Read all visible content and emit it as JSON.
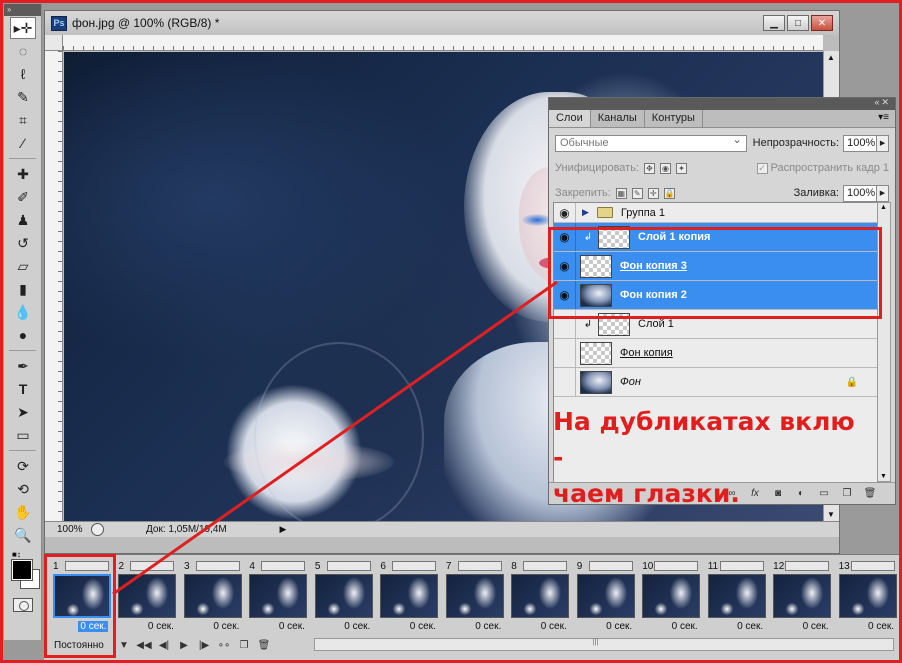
{
  "document": {
    "title": "фон.jpg @ 100% (RGB/8) *",
    "ps_badge": "Ps",
    "zoom": "100%",
    "doc_info": "Док: 1,05M/19,4M"
  },
  "layers_panel": {
    "tabs": [
      "Слои",
      "Каналы",
      "Контуры"
    ],
    "blend_mode": "Обычные",
    "opacity_label": "Непрозрачность:",
    "opacity_value": "100%",
    "unify_label": "Унифицировать:",
    "propagate_label": "Распространить кадр 1",
    "lock_label": "Закрепить:",
    "fill_label": "Заливка:",
    "fill_value": "100%",
    "layers": [
      {
        "name": "Группа 1",
        "type": "group",
        "visible": true,
        "selected": false
      },
      {
        "name": "Слой 1 копия",
        "type": "clipped",
        "visible": true,
        "selected": true
      },
      {
        "name": "Фон копия 3",
        "type": "transparent",
        "visible": true,
        "selected": true
      },
      {
        "name": "Фон копия 2",
        "type": "photo",
        "visible": true,
        "selected": true
      },
      {
        "name": "Слой 1",
        "type": "clipped",
        "visible": false,
        "selected": false
      },
      {
        "name": "Фон копия",
        "type": "transparent",
        "visible": false,
        "selected": false
      },
      {
        "name": "Фон",
        "type": "photo-locked",
        "visible": false,
        "selected": false
      }
    ],
    "bottom_icons": [
      "link-icon",
      "fx-icon",
      "mask-icon",
      "adjustment-icon",
      "folder-icon",
      "new-layer-icon",
      "trash-icon"
    ]
  },
  "annotation": {
    "line1": "На дубликатах вклю -",
    "line2": "чаем глазки."
  },
  "timeline": {
    "frames": [
      {
        "num": "1",
        "delay": "0 сек."
      },
      {
        "num": "2",
        "delay": "0 сек."
      },
      {
        "num": "3",
        "delay": "0 сек."
      },
      {
        "num": "4",
        "delay": "0 сек."
      },
      {
        "num": "5",
        "delay": "0 сек."
      },
      {
        "num": "6",
        "delay": "0 сек."
      },
      {
        "num": "7",
        "delay": "0 сек."
      },
      {
        "num": "8",
        "delay": "0 сек."
      },
      {
        "num": "9",
        "delay": "0 сек."
      },
      {
        "num": "10",
        "delay": "0 сек."
      },
      {
        "num": "11",
        "delay": "0 сек."
      },
      {
        "num": "12",
        "delay": "0 сек."
      },
      {
        "num": "13",
        "delay": "0 сек."
      }
    ],
    "loop": "Постоянно"
  },
  "colors": {
    "selection": "#3a8ef0",
    "annotation": "#e01e1e"
  }
}
